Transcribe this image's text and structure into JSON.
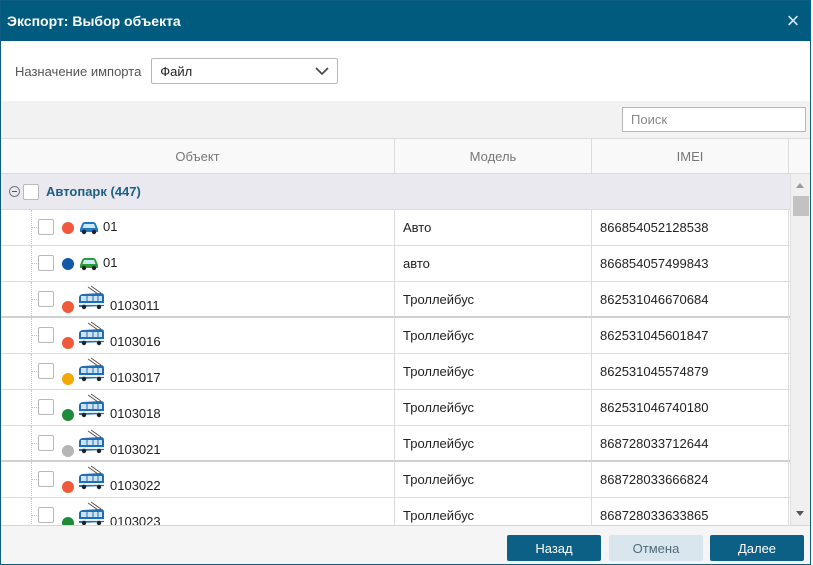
{
  "dialog": {
    "title": "Экспорт: Выбор объекта",
    "close_icon": "×"
  },
  "form": {
    "import_label": "Назначение импорта",
    "import_value": "Файл"
  },
  "search": {
    "placeholder": "Поиск"
  },
  "table": {
    "columns": [
      "Объект",
      "Модель",
      "IMEI"
    ],
    "group": {
      "label": "Автопарк (447)"
    },
    "rows": [
      {
        "name": "01",
        "model": "Авто",
        "imei": "86685405212853​8",
        "status_color": "#f05a3a",
        "icon": "car-blue-icon"
      },
      {
        "name": "01",
        "model": "авто",
        "imei": "866854057499843",
        "status_color": "#1458a8",
        "icon": "car-green-icon"
      },
      {
        "name": "0103011",
        "model": "Троллейбус",
        "imei": "862531046670684",
        "status_color": "#f05a3a",
        "icon": "trolleybus-icon"
      },
      {
        "name": "0103016",
        "model": "Троллейбус",
        "imei": "862531045601847",
        "status_color": "#f05a3a",
        "icon": "trolleybus-icon"
      },
      {
        "name": "0103017",
        "model": "Троллейбус",
        "imei": "862531045574879",
        "status_color": "#f5a800",
        "icon": "trolleybus-icon"
      },
      {
        "name": "0103018",
        "model": "Троллейбус",
        "imei": "862531046740180",
        "status_color": "#1e8a3a",
        "icon": "trolleybus-icon"
      },
      {
        "name": "0103021",
        "model": "Троллейбус",
        "imei": "868728033712644",
        "status_color": "#b5b5b5",
        "icon": "trolleybus-icon"
      },
      {
        "name": "0103022",
        "model": "Троллейбус",
        "imei": "868728033666824",
        "status_color": "#f05a3a",
        "icon": "trolleybus-icon"
      },
      {
        "name": "0103023",
        "model": "Троллейбус",
        "imei": "868728033633865",
        "status_color": "#1e8a3a",
        "icon": "trolleybus-icon"
      }
    ]
  },
  "buttons": {
    "back": "Назад",
    "cancel": "Отмена",
    "next": "Далее"
  },
  "colors": {
    "titlebar": "#015b7f",
    "primary_button": "#0c5f85",
    "group_text": "#1d5f85"
  }
}
